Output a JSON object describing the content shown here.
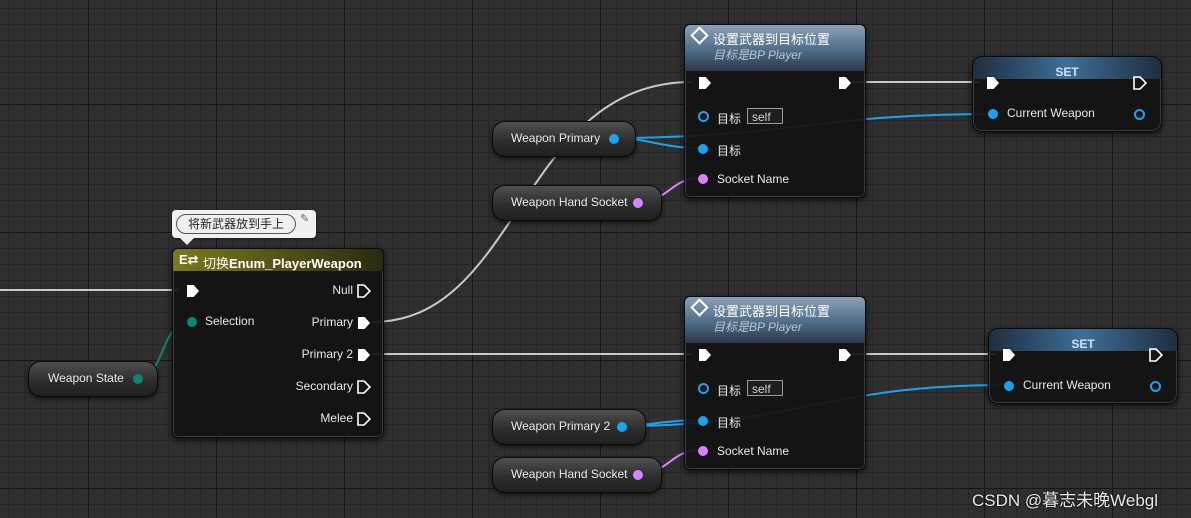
{
  "nodes": {
    "switch": {
      "title_prefix": "切换",
      "title": "Enum_PlayerWeapon",
      "selection_label": "Selection",
      "outputs": [
        "Null",
        "Primary",
        "Primary 2",
        "Secondary",
        "Melee"
      ]
    },
    "attach1": {
      "title": "设置武器到目标位置",
      "subtitle_prefix": "目标是",
      "subtitle_target": "BP Player",
      "target_label": "目标",
      "target_default": "self",
      "target2_label": "目标",
      "socket_label": "Socket Name"
    },
    "attach2": {
      "title": "设置武器到目标位置",
      "subtitle_prefix": "目标是",
      "subtitle_target": "BP Player",
      "target_label": "目标",
      "target_default": "self",
      "target2_label": "目标",
      "socket_label": "Socket Name"
    },
    "set1": {
      "title": "SET",
      "var_label": "Current Weapon"
    },
    "set2": {
      "title": "SET",
      "var_label": "Current Weapon"
    }
  },
  "variables": {
    "weapon_state": "Weapon State",
    "weapon_primary": "Weapon Primary",
    "hand_socket_1": "Weapon Hand Socket",
    "weapon_primary_2": "Weapon Primary 2",
    "hand_socket_2": "Weapon Hand Socket"
  },
  "comment": {
    "text": "将新武器放到手上"
  },
  "watermark": "CSDN @暮志未晚Webgl",
  "colors": {
    "object_pin": "#1aa3ef",
    "name_pin": "#d783ff",
    "enum_pin": "#0e8472",
    "exec_wire": "#c8c8c8"
  }
}
